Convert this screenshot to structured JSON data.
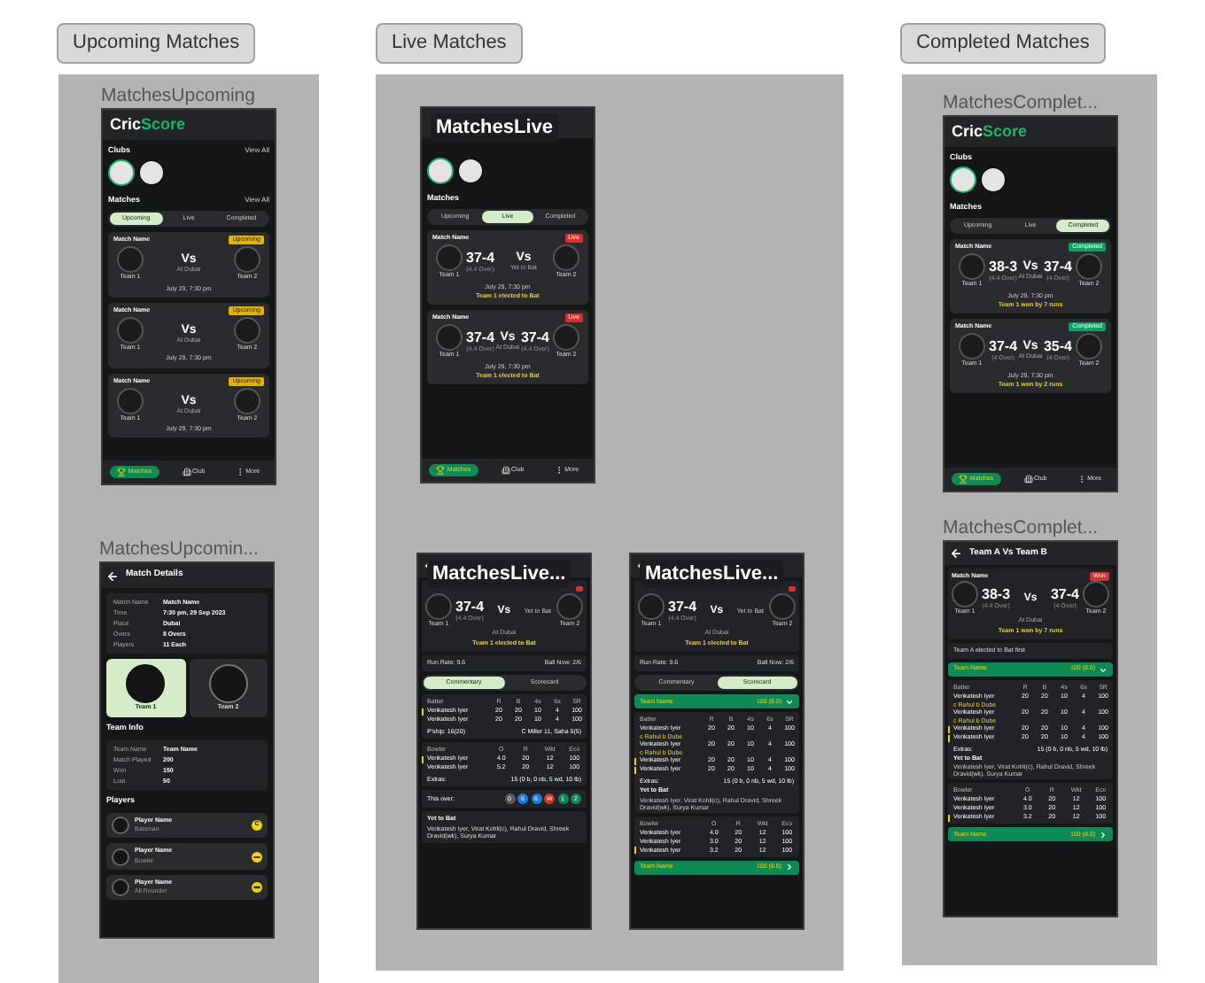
{
  "sections": [
    {
      "tag": "Upcoming Matches",
      "frames": [
        {
          "kind": "home",
          "label": "MatchesUpcoming",
          "label_overlay": false,
          "logo": [
            "Cric",
            "Score"
          ],
          "clubs": {
            "heading": "Clubs",
            "link": "View All",
            "items": [
              {
                "selected": true
              },
              {
                "selected": false
              }
            ]
          },
          "matches": {
            "heading": "Matches",
            "link": "View All",
            "tabs": [
              {
                "label": "Upcoming",
                "selected": true
              },
              {
                "label": "Live",
                "selected": false
              },
              {
                "label": "Completed",
                "selected": false
              }
            ],
            "cards": [
              {
                "title": "Match Name",
                "badge": "Upcoming",
                "kind": "upcoming",
                "teams": [
                  {
                    "name": "Team 1"
                  },
                  {
                    "name": "Team 2"
                  }
                ],
                "vs": "Vs",
                "middle": "At Dubai",
                "date": "July 29, 7:30 pm"
              },
              {
                "title": "Match Name",
                "badge": "Upcoming",
                "kind": "upcoming",
                "teams": [
                  {
                    "name": "Team 1"
                  },
                  {
                    "name": "Team 2"
                  }
                ],
                "vs": "Vs",
                "middle": "At Dubai",
                "date": "July 29, 7:30 pm"
              },
              {
                "title": "Match Name",
                "badge": "Upcoming",
                "kind": "upcoming",
                "teams": [
                  {
                    "name": "Team 1"
                  },
                  {
                    "name": "Team 2"
                  }
                ],
                "vs": "Vs",
                "middle": "At Dubai",
                "date": "July 29, 7:30 pm"
              }
            ]
          },
          "nav": [
            {
              "label": "Matches",
              "selected": true
            },
            {
              "label": "Club",
              "selected": false
            },
            {
              "label": "More",
              "selected": false
            }
          ]
        },
        {
          "kind": "details",
          "label": "MatchesUpcomin...",
          "label_overlay": false,
          "title": "Match Details",
          "info": [
            [
              "Match Name",
              "Match Name"
            ],
            [
              "Time",
              "7:30 pm, 29 Sep 2023"
            ],
            [
              "Place",
              "Dubai"
            ],
            [
              "Overs",
              "8 Overs"
            ],
            [
              "Players",
              "11 Each"
            ]
          ],
          "teams": [
            {
              "name": "Team 1",
              "selected": true
            },
            {
              "name": "Team 2",
              "selected": false
            }
          ],
          "team_info": {
            "heading": "Team Info",
            "rows": [
              [
                "Team Name",
                "Team Name"
              ],
              [
                "Match Played",
                "200"
              ],
              [
                "Won",
                "150"
              ],
              [
                "Lost",
                "50"
              ]
            ]
          },
          "players": {
            "heading": "Players",
            "items": [
              {
                "name": "Player Name",
                "role": "Batsman",
                "kind": "captain",
                "badge": "C"
              },
              {
                "name": "Player Name",
                "role": "Bowler",
                "kind": "bowler"
              },
              {
                "name": "Player Name",
                "role": "All Rounder",
                "kind": "batsman"
              }
            ]
          }
        }
      ]
    },
    {
      "tag": "Live Matches",
      "frames": [
        {
          "kind": "home",
          "label": "MatchesLive",
          "label_overlay": true,
          "clubs": {
            "items": [
              {
                "selected": true
              },
              {
                "selected": false
              }
            ]
          },
          "matches": {
            "heading": "Matches",
            "tabs": [
              {
                "label": "Upcoming",
                "selected": false
              },
              {
                "label": "Live",
                "selected": true
              },
              {
                "label": "Completed",
                "selected": false
              }
            ],
            "cards": [
              {
                "title": "Match Name",
                "badge": "Live",
                "kind": "live",
                "teams": [
                  {
                    "name": "Team 1",
                    "score": "37-4",
                    "overs": "(4.4 Over)"
                  },
                  {
                    "name": "Team 2"
                  }
                ],
                "vs": "Vs",
                "middle": "Yet to Bat",
                "date": "July 29, 7:30 pm",
                "result": "Team 1 elected to Bat"
              },
              {
                "title": "Match Name",
                "badge": "Live",
                "kind": "live",
                "teams": [
                  {
                    "name": "Team 1",
                    "score": "37-4",
                    "overs": "(4.4 Over)"
                  },
                  {
                    "name": "Team 2",
                    "score": "37-4",
                    "overs": "(4.4 Over)"
                  }
                ],
                "vs": "Vs",
                "middle": "At Dubai",
                "date": "July 29, 7:30 pm",
                "result": "Team 1 elected to Bat"
              }
            ]
          },
          "nav": [
            {
              "label": "Matches",
              "selected": true
            },
            {
              "label": "Club",
              "selected": false
            },
            {
              "label": "More",
              "selected": false
            }
          ]
        },
        {
          "kind": "scorecard",
          "label": "MatchesLive...",
          "label_overlay": true,
          "score": {
            "kind": "live",
            "teams": [
              {
                "name": "Team 1",
                "score": "37-4",
                "overs": "(4.4 Over)"
              },
              {
                "name": "Team 2"
              }
            ],
            "vs": "Vs",
            "right_note": "Yet to Bat",
            "middle": "At Dubai",
            "result": "Team 1 elected to Bat"
          },
          "info": [
            "Run Rate: 9.6",
            "Ball Now: 2/6"
          ],
          "tabs": [
            {
              "label": "Commentary",
              "selected": true
            },
            {
              "label": "Scorecard",
              "selected": false
            }
          ],
          "blocks": [
            {
              "kind": "table",
              "columns": [
                "Batter",
                "R",
                "B",
                "4s",
                "6s",
                "SR"
              ],
              "rows": [
                {
                  "cells": [
                    "Venkatesh Iyer",
                    "20",
                    "20",
                    "10",
                    "4",
                    "100"
                  ],
                  "striker": true
                },
                {
                  "cells": [
                    "Venkatesh Iyer",
                    "20",
                    "20",
                    "10",
                    "4",
                    "100"
                  ],
                  "striker": false
                }
              ],
              "pair": [
                "P'ship: 16(20)",
                "C Miller 11, Saha 5(5)"
              ]
            },
            {
              "kind": "table",
              "columns": [
                "Bowler",
                "O",
                "R",
                "Wkt",
                "Eco"
              ],
              "rows": [
                {
                  "cells": [
                    "Venkatesh Iyer",
                    "4.0",
                    "20",
                    "12",
                    "100"
                  ],
                  "striker": true
                },
                {
                  "cells": [
                    "Venkatesh Iyer",
                    "5.2",
                    "20",
                    "12",
                    "100"
                  ],
                  "striker": false
                }
              ],
              "pair": [
                "Extras:",
                "15 (0 b, 0 nb, 5 wd, 10 lb)"
              ]
            },
            {
              "kind": "over",
              "label": "This over:",
              "balls": [
                {
                  "text": "0",
                  "color": "#5a5a5a"
                },
                {
                  "text": "6",
                  "color": "#1f7ae0"
                },
                {
                  "text": "6",
                  "color": "#1f7ae0"
                },
                {
                  "text": "W",
                  "color": "#d8302c"
                },
                {
                  "text": "1",
                  "color": "#12875a"
                },
                {
                  "text": "2",
                  "color": "#12875a"
                }
              ]
            },
            {
              "kind": "yet",
              "heading": "Yet to Bat",
              "text": "Venkatesh Iyer, Virat Kohli(c), Rahul Dravid, Shreek Dravid(wk), Surya Kumar"
            }
          ]
        },
        {
          "kind": "scorecard",
          "label": "MatchesLive...",
          "label_overlay": true,
          "score": {
            "kind": "live",
            "teams": [
              {
                "name": "Team 1",
                "score": "37-4",
                "overs": "(4.4 Over)"
              },
              {
                "name": "Team 2"
              }
            ],
            "vs": "Vs",
            "right_note": "Yet to Bat",
            "middle": "At Dubai",
            "result": "Team 1 elected to Bat"
          },
          "info": [
            "Run Rate: 9.6",
            "Ball Now: 2/6"
          ],
          "tabs": [
            {
              "label": "Commentary",
              "selected": false
            },
            {
              "label": "Scorecard",
              "selected": true
            }
          ],
          "blocks": [
            {
              "kind": "team_bar",
              "name": "Team Name",
              "score": "100 (8.0)",
              "expanded": true
            },
            {
              "kind": "table",
              "columns": [
                "Batter",
                "R",
                "B",
                "4s",
                "6s",
                "SR"
              ],
              "rows": [
                {
                  "cells": [
                    "Venkatesh Iyer",
                    "20",
                    "20",
                    "10",
                    "4",
                    "100"
                  ],
                  "striker": false,
                  "sub": "c Rahul b Dube"
                },
                {
                  "cells": [
                    "Venkatesh Iyer",
                    "20",
                    "20",
                    "10",
                    "4",
                    "100"
                  ],
                  "striker": false,
                  "sub": "c Rahul b Dube"
                },
                {
                  "cells": [
                    "Venkatesh Iyer",
                    "20",
                    "20",
                    "10",
                    "4",
                    "100"
                  ],
                  "striker": true
                },
                {
                  "cells": [
                    "Venkatesh Iyer",
                    "20",
                    "20",
                    "10",
                    "4",
                    "100"
                  ],
                  "striker": true
                }
              ],
              "pair": [
                "Extras:",
                "15 (0 b, 0 nb, 5 wd, 10 lb)"
              ],
              "yet": [
                "Yet to Bat",
                "Venkatesh Iyer, Virat Kohli(c), Rahul Dravid, Shreek Dravid(wk), Surya Kumar"
              ]
            },
            {
              "kind": "table",
              "columns": [
                "Bowler",
                "O",
                "R",
                "Wkt",
                "Eco"
              ],
              "rows": [
                {
                  "cells": [
                    "Venkatesh Iyer",
                    "4.0",
                    "20",
                    "12",
                    "100"
                  ],
                  "striker": false
                },
                {
                  "cells": [
                    "Venkatesh Iyer",
                    "3.0",
                    "20",
                    "12",
                    "100"
                  ],
                  "striker": false
                },
                {
                  "cells": [
                    "Venkatesh Iyer",
                    "3.2",
                    "20",
                    "12",
                    "100"
                  ],
                  "striker": true
                }
              ]
            },
            {
              "kind": "team_bar",
              "name": "Team Name",
              "score": "100 (8.0)",
              "expanded": false
            }
          ]
        }
      ]
    },
    {
      "tag": "Completed Matches",
      "frames": [
        {
          "kind": "home",
          "label": "MatchesComplet...",
          "label_overlay": false,
          "logo": [
            "Cric",
            "Score"
          ],
          "clubs": {
            "heading": "Clubs",
            "items": [
              {
                "selected": true
              },
              {
                "selected": false
              }
            ]
          },
          "matches": {
            "heading": "Matches",
            "tabs": [
              {
                "label": "Upcoming",
                "selected": false
              },
              {
                "label": "Live",
                "selected": false
              },
              {
                "label": "Completed",
                "selected": true
              }
            ],
            "cards": [
              {
                "title": "Match Name",
                "badge": "Completed",
                "kind": "completed",
                "teams": [
                  {
                    "name": "Team 1",
                    "score": "38-3",
                    "overs": "(4.4 Over)"
                  },
                  {
                    "name": "Team 2",
                    "score": "37-4",
                    "overs": "(4 Over)"
                  }
                ],
                "vs": "Vs",
                "middle": "At Dubai",
                "date": "July 29, 7:30 pm",
                "result": "Team 1 won by 7 runs"
              },
              {
                "title": "Match Name",
                "badge": "Completed",
                "kind": "completed",
                "teams": [
                  {
                    "name": "Team 1",
                    "score": "37-4",
                    "overs": "(4 Over)"
                  },
                  {
                    "name": "Team 2",
                    "score": "35-4",
                    "overs": "(4 Over)"
                  }
                ],
                "vs": "Vs",
                "middle": "At Dubai",
                "date": "July 29, 7:30 pm",
                "result": "Team 1 won by 2 runs"
              }
            ]
          },
          "nav": [
            {
              "label": "Matches",
              "selected": true
            },
            {
              "label": "Club",
              "selected": false
            },
            {
              "label": "More",
              "selected": false
            }
          ]
        },
        {
          "kind": "scorecard",
          "label": "MatchesComplet...",
          "label_overlay": false,
          "title": "Team A Vs Team B",
          "score": {
            "kind": "live",
            "title": "Match Name",
            "badge": "Won",
            "teams": [
              {
                "name": "Team 1",
                "score": "38-3",
                "overs": "(4.4 Over)"
              },
              {
                "name": "Team 2",
                "score": "37-4",
                "overs": "(4 Over)"
              }
            ],
            "vs": "Vs",
            "middle": "At Dubai",
            "result": "Team 1 won by 7 runs"
          },
          "info": [
            "Team A elected to Bat first"
          ],
          "blocks": [
            {
              "kind": "team_bar",
              "name": "Team Name",
              "score": "100 (8.0)",
              "expanded": true
            },
            {
              "kind": "table",
              "columns": [
                "Batter",
                "R",
                "B",
                "4s",
                "6s",
                "SR"
              ],
              "rows": [
                {
                  "cells": [
                    "Venkatesh Iyer",
                    "20",
                    "20",
                    "10",
                    "4",
                    "100"
                  ],
                  "striker": false,
                  "sub": "c Rahul b Dube"
                },
                {
                  "cells": [
                    "Venkatesh Iyer",
                    "20",
                    "20",
                    "10",
                    "4",
                    "100"
                  ],
                  "striker": false,
                  "sub": "c Rahul b Dube"
                },
                {
                  "cells": [
                    "Venkatesh Iyer",
                    "20",
                    "20",
                    "10",
                    "4",
                    "100"
                  ],
                  "striker": true
                },
                {
                  "cells": [
                    "Venkatesh Iyer",
                    "20",
                    "20",
                    "10",
                    "4",
                    "100"
                  ],
                  "striker": true
                }
              ],
              "pair": [
                "Extras:",
                "15 (0 b, 0 nb, 5 wd, 10 lb)"
              ],
              "yet": [
                "Yet to Bat",
                "Venkatesh Iyer, Virat Kohli(c), Rahul Dravid, Shreek Dravid(wk), Surya Kumar"
              ]
            },
            {
              "kind": "table",
              "columns": [
                "Bowler",
                "O",
                "R",
                "Wkt",
                "Eco"
              ],
              "rows": [
                {
                  "cells": [
                    "Venkatesh Iyer",
                    "4.0",
                    "20",
                    "12",
                    "100"
                  ],
                  "striker": false
                },
                {
                  "cells": [
                    "Venkatesh Iyer",
                    "3.0",
                    "20",
                    "12",
                    "100"
                  ],
                  "striker": false
                },
                {
                  "cells": [
                    "Venkatesh Iyer",
                    "3.2",
                    "20",
                    "12",
                    "100"
                  ],
                  "striker": true
                }
              ]
            },
            {
              "kind": "team_bar",
              "name": "Team Name",
              "score": "100 (8.0)",
              "expanded": false
            }
          ]
        }
      ]
    }
  ]
}
